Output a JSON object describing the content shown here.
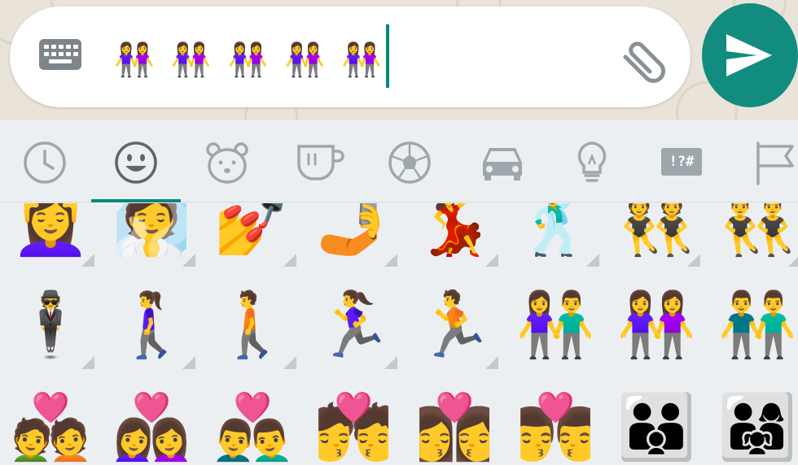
{
  "colors": {
    "accent": "#00897b",
    "send_button": "#128c7e",
    "chat_background": "#e9e3d9",
    "keyboard_background": "#eceff1",
    "icon_gray": "#9ea7ab"
  },
  "input": {
    "typed_emoji": [
      "👭",
      "👭",
      "👭",
      "👭",
      "👭"
    ],
    "keyboard_icon": "keyboard-icon",
    "attach_icon": "paperclip-icon"
  },
  "send_icon": "send-icon",
  "tabs": [
    {
      "icon": "clock-icon",
      "active": false
    },
    {
      "icon": "smiley-icon",
      "active": true
    },
    {
      "icon": "bear-icon",
      "active": false
    },
    {
      "icon": "cup-icon",
      "active": false
    },
    {
      "icon": "soccer-ball-icon",
      "active": false
    },
    {
      "icon": "car-icon",
      "active": false
    },
    {
      "icon": "lightbulb-icon",
      "active": false
    },
    {
      "icon": "symbols-icon",
      "label": "!?#",
      "active": false
    },
    {
      "icon": "flag-icon",
      "active": false
    }
  ],
  "emoji_grid": [
    [
      {
        "e": "💆‍♀️",
        "variants": true
      },
      {
        "e": "🧖",
        "variants": true
      },
      {
        "e": "💅",
        "variants": true
      },
      {
        "e": "🤳",
        "variants": true
      },
      {
        "e": "💃",
        "variants": true
      },
      {
        "e": "🕺",
        "variants": true
      },
      {
        "e": "👯",
        "variants": true
      },
      {
        "e": "👯‍♂️",
        "variants": true
      }
    ],
    [
      {
        "e": "🕴️",
        "variants": true
      },
      {
        "e": "🚶‍♀️",
        "variants": true
      },
      {
        "e": "🚶",
        "variants": true
      },
      {
        "e": "🏃‍♀️",
        "variants": true
      },
      {
        "e": "🏃",
        "variants": true
      },
      {
        "e": "👫",
        "variants": false
      },
      {
        "e": "👭",
        "variants": false
      },
      {
        "e": "👬",
        "variants": false
      }
    ],
    [
      {
        "e": "💑",
        "variants": false
      },
      {
        "e": "👩‍❤️‍👩",
        "variants": false
      },
      {
        "e": "👨‍❤️‍👨",
        "variants": false
      },
      {
        "e": "💏",
        "variants": false
      },
      {
        "e": "👩‍❤️‍💋‍👩",
        "variants": false
      },
      {
        "e": "👨‍❤️‍💋‍👨",
        "variants": false
      },
      {
        "e": "👪",
        "variants": false
      },
      {
        "e": "👨‍👩‍👧",
        "variants": false
      }
    ]
  ]
}
